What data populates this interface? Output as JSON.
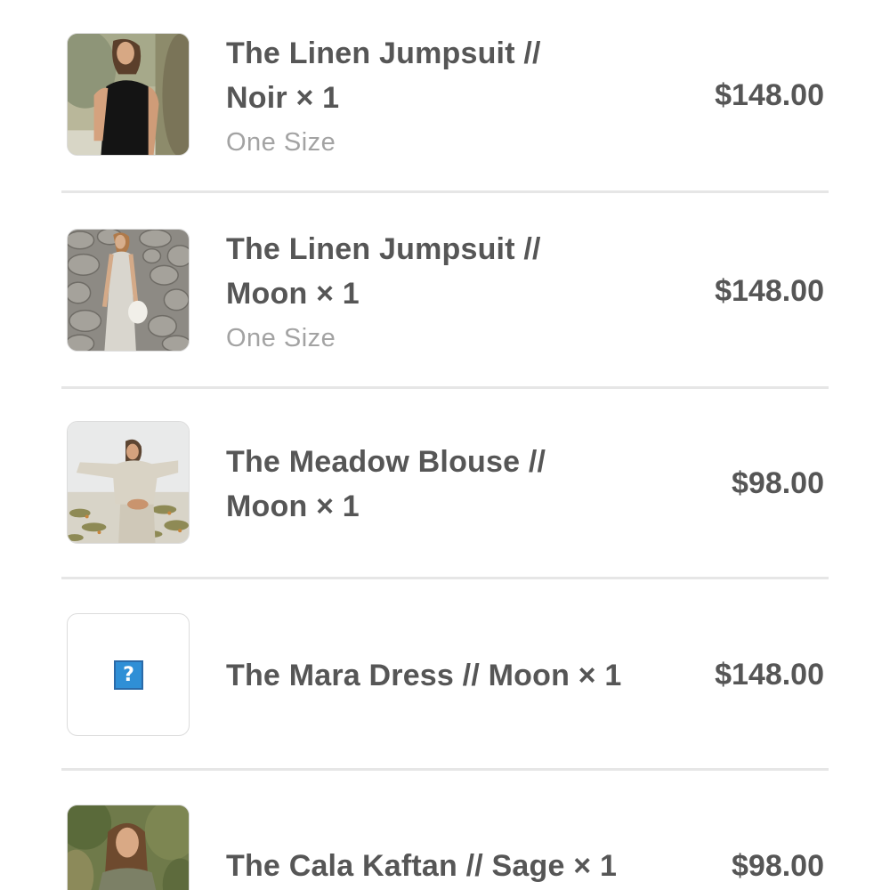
{
  "items": [
    {
      "name_line1": "The Linen Jumpsuit //",
      "name_line2": "Noir × 1",
      "variant": "One Size",
      "price": "$148.00",
      "image": "photo-woman-black-jumpsuit"
    },
    {
      "name_line1": "The Linen Jumpsuit //",
      "name_line2": "Moon × 1",
      "variant": "One Size",
      "price": "$148.00",
      "image": "photo-woman-stone-wall"
    },
    {
      "name_line1": "The Meadow Blouse //",
      "name_line2": "Moon × 1",
      "price": "$98.00",
      "image": "photo-woman-beach-blouse"
    },
    {
      "name_line1": "The Mara Dress // Moon × 1",
      "price": "$148.00",
      "image": "missing-image-icon",
      "missing_glyph": "?"
    },
    {
      "name_line1": "The Cala Kaftan // Sage × 1",
      "price": "$98.00",
      "image": "photo-woman-green-kaftan"
    }
  ],
  "colors": {
    "text": "#565656",
    "variant": "#a3a3a3",
    "divider": "#e6e6e6",
    "missing_icon": "#2f8fd6"
  }
}
